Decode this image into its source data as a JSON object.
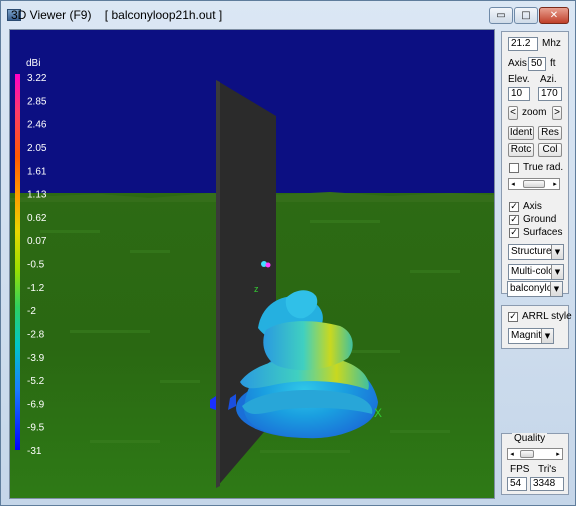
{
  "window": {
    "title": "3D Viewer (F9)    [ balconyloop21h.out ]",
    "minimize_glyph": "▭",
    "maximize_glyph": "□",
    "close_glyph": "✕"
  },
  "colorbar": {
    "title": "dBi",
    "ticks": [
      "3.22",
      "2.85",
      "2.46",
      "2.05",
      "1.61",
      "1.13",
      "0.62",
      "0.07",
      "-0.5",
      "-1.2",
      "-2",
      "-2.8",
      "-3.9",
      "-5.2",
      "-6.9",
      "-9.5",
      "-31"
    ]
  },
  "controls": {
    "frequency": "21.2",
    "frequency_unit": "Mhz",
    "axis_label": "Axis",
    "axis_value": "50",
    "axis_unit": "ft",
    "elev_label": "Elev.",
    "azi_label": "Azi.",
    "elev_value": "10",
    "azi_value": "170",
    "zoom_prev": "<",
    "zoom_label": "zoom",
    "zoom_next": ">",
    "ident_button": "Ident",
    "res_button": "Res",
    "rotc_button": "Rotc",
    "col_button": "Col",
    "true_rad_label": "True rad.",
    "true_rad_checked": false,
    "axis_check_label": "Axis",
    "axis_checked": true,
    "ground_label": "Ground",
    "ground_checked": true,
    "surfaces_label": "Surfaces",
    "surfaces_checked": true,
    "structure_select": "Structure",
    "color_select": "Multi-colo",
    "file_select": "balconylo",
    "arrl_label": "ARRL style",
    "arrl_checked": true,
    "magnitude_select": "Magnitu",
    "quality_label": "Quality",
    "fps_label": "FPS",
    "tris_label": "Tri's",
    "fps_value": "54",
    "tris_value": "3348"
  },
  "colors": {
    "sky": "#0c0f82",
    "ground": "#2f6b16",
    "plane": "#2b2b2b",
    "accent_marker": "#33cc33"
  },
  "scene": {
    "axis_marker": "X"
  }
}
